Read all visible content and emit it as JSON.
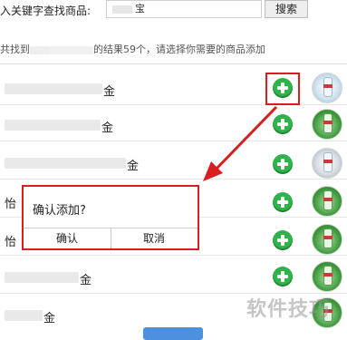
{
  "search": {
    "label": "入关键字查找商品:",
    "input_value": "宝",
    "button_label": "搜索"
  },
  "results": {
    "summary_start": "共找到",
    "summary_end": "的结果59个，请选择你需要的商品添加"
  },
  "products": [
    {
      "name_suffix": "金",
      "thumb": "water"
    },
    {
      "name_suffix": "金",
      "thumb": "green"
    },
    {
      "name_suffix": "金",
      "thumb": "gray"
    },
    {
      "name_suffix": "怡",
      "thumb": "green"
    },
    {
      "name_suffix": "怡",
      "thumb": "green"
    },
    {
      "name_suffix": "金",
      "thumb": "green"
    },
    {
      "name_suffix": "金",
      "thumb": "green"
    }
  ],
  "dialog": {
    "message": "确认添加?",
    "confirm_label": "确认",
    "cancel_label": "取消"
  },
  "watermark": "软件技巧",
  "colors": {
    "accent_red": "#d81e1e",
    "add_green": "#2fb34a"
  }
}
